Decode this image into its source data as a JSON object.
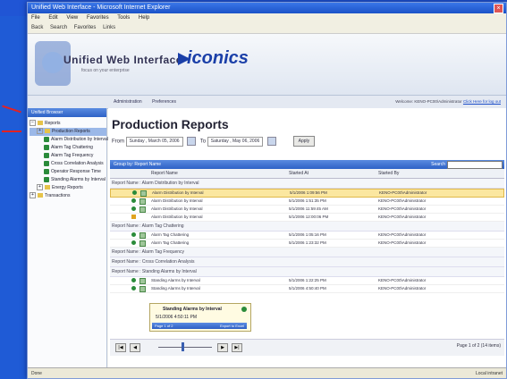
{
  "top_title": "...",
  "browser": {
    "title": "Unified Web Interface - Microsoft Internet Explorer",
    "menu": [
      "File",
      "Edit",
      "View",
      "Favorites",
      "Tools",
      "Help"
    ],
    "toolbar": [
      "Back",
      "Search",
      "Favorites",
      "Links"
    ]
  },
  "banner": {
    "product_name": "Unified Web Interface",
    "product_tagline": "focus on your enterprise",
    "brand": "iconics"
  },
  "nav": {
    "tabs": [
      "Administration",
      "Preferences"
    ],
    "welcome": "Welcome: KENO-PC00\\Administrator",
    "logout_link": "Click Here for log out"
  },
  "sidebar": {
    "header": "Unified Browser",
    "tree": [
      {
        "label": "Reports",
        "level": 0,
        "kind": "folder",
        "expanded": true
      },
      {
        "label": "Production Reports",
        "level": 1,
        "kind": "folder",
        "selected": true
      },
      {
        "label": "Alarm Distribution by Interval",
        "level": 2,
        "kind": "report"
      },
      {
        "label": "Alarm Tag Chattering",
        "level": 2,
        "kind": "report"
      },
      {
        "label": "Alarm Tag Frequency",
        "level": 2,
        "kind": "report"
      },
      {
        "label": "Cross Correlation Analysis",
        "level": 2,
        "kind": "report"
      },
      {
        "label": "Operator Response Time",
        "level": 2,
        "kind": "report"
      },
      {
        "label": "Standing Alarms by Interval",
        "level": 2,
        "kind": "report"
      },
      {
        "label": "Energy Reports",
        "level": 1,
        "kind": "folder"
      },
      {
        "label": "Transactions",
        "level": 0,
        "kind": "folder"
      }
    ]
  },
  "page": {
    "title": "Production Reports",
    "from_label": "From",
    "from_date": "Sunday , March  05, 2006",
    "to_label": "To",
    "to_date": "Saturday , May  06, 2006",
    "apply_label": "Apply"
  },
  "grid": {
    "group_by": "Group by: Report Name",
    "search_label": "Search",
    "columns": [
      "",
      "Report Name",
      "Started At",
      "Started By"
    ],
    "groups": [
      {
        "header": "Report Name : Alarm Distribution by Interval",
        "rows": [
          {
            "name": "Alarm Distribution by Interval",
            "started_at": "5/1/2006 1:09:56 PM",
            "started_by": "KENO-PC00\\Administrator",
            "highlight": true,
            "status": "ok"
          },
          {
            "name": "Alarm Distribution by Interval",
            "started_at": "5/1/2006 1:51:35 PM",
            "started_by": "KENO-PC00\\Administrator",
            "status": "ok"
          },
          {
            "name": "Alarm Distribution by Interval",
            "started_at": "5/1/2006 11:59:45 AM",
            "started_by": "KENO-PC00\\Administrator",
            "status": "ok"
          },
          {
            "name": "Alarm Distribution by Interval",
            "started_at": "5/1/2006 12:00:06 PM",
            "started_by": "KENO-PC00\\Administrator",
            "status": "warn"
          }
        ]
      },
      {
        "header": "Report Name : Alarm Tag Chattering",
        "rows": [
          {
            "name": "Alarm Tag Chattering",
            "started_at": "5/1/2006 1:05:16 PM",
            "started_by": "KENO-PC00\\Administrator",
            "status": "ok"
          },
          {
            "name": "Alarm Tag Chattering",
            "started_at": "5/1/2006 1:23:32 PM",
            "started_by": "KENO-PC00\\Administrator",
            "status": "ok"
          }
        ]
      },
      {
        "header": "Report Name : Alarm Tag Frequency",
        "rows": []
      },
      {
        "header": "Report Name : Cross Correlation Analysis",
        "rows": []
      },
      {
        "header": "Report Name : Standing Alarms by Interval",
        "rows": [
          {
            "name": "Standing Alarms by Interval",
            "started_at": "5/1/2006 1:22:25 PM",
            "started_by": "KENO-PC00\\Administrator",
            "status": "ok"
          },
          {
            "name": "Standing Alarms by Interval",
            "started_at": "5/1/2006 4:50:40 PM",
            "started_by": "KENO-PC00\\Administrator",
            "status": "ok"
          }
        ]
      }
    ]
  },
  "tooltip": {
    "title": "Standing Alarms by Interval",
    "time": "5/1/2006 4:50:11 PM",
    "bar_left": "Page 1 of 2",
    "bar_right": "Export to Excel"
  },
  "pager": {
    "first": "|◀",
    "prev": "◀",
    "next": "▶",
    "last": "▶|",
    "info": "Page 1 of 2 (14 items)"
  },
  "status": {
    "left": "Done",
    "right": "Local intranet"
  }
}
